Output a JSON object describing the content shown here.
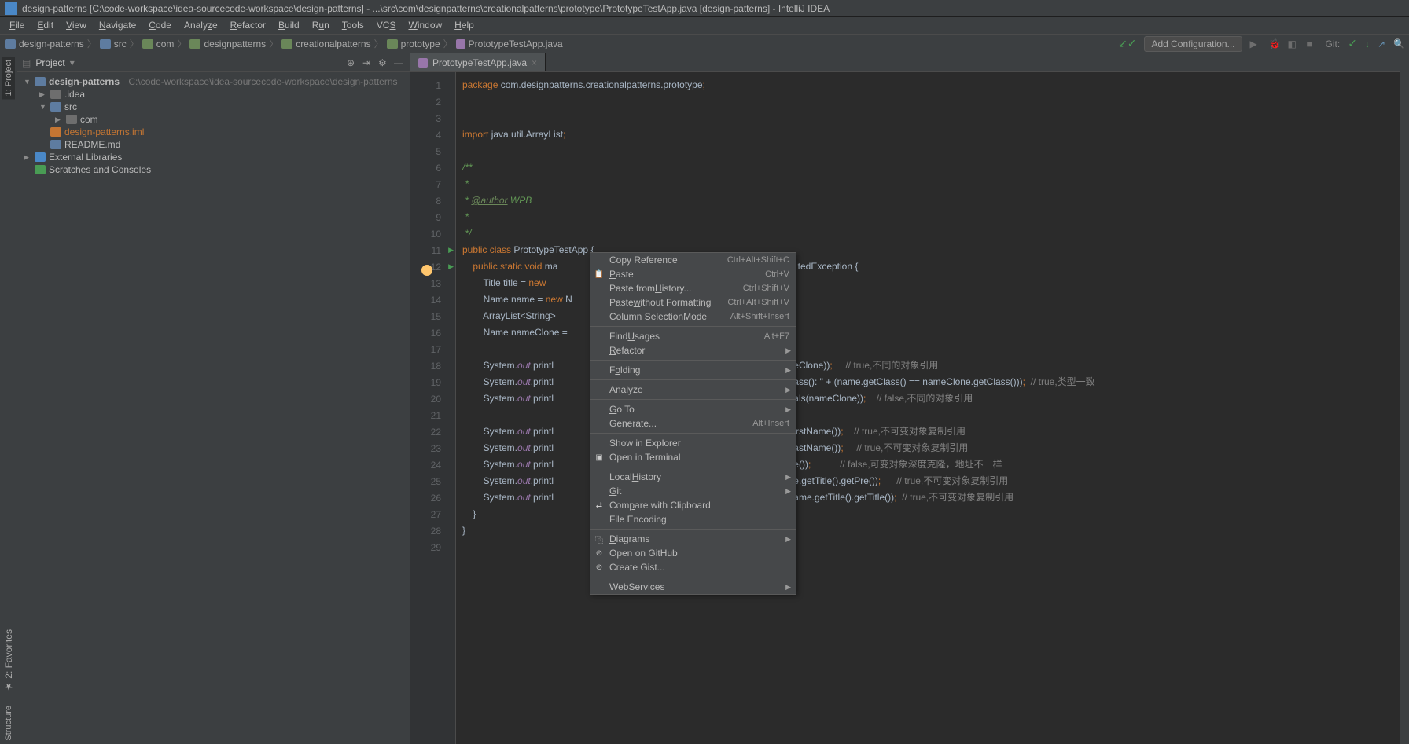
{
  "title": "design-patterns [C:\\code-workspace\\idea-sourcecode-workspace\\design-patterns] - ...\\src\\com\\designpatterns\\creationalpatterns\\prototype\\PrototypeTestApp.java [design-patterns] - IntelliJ IDEA",
  "menu": [
    "File",
    "Edit",
    "View",
    "Navigate",
    "Code",
    "Analyze",
    "Refactor",
    "Build",
    "Run",
    "Tools",
    "VCS",
    "Window",
    "Help"
  ],
  "breadcrumbs": [
    "design-patterns",
    "src",
    "com",
    "designpatterns",
    "creationalpatterns",
    "prototype",
    "PrototypeTestApp.java"
  ],
  "nav": {
    "addconf": "Add Configuration...",
    "git": "Git:"
  },
  "left_tabs": [
    "1: Project",
    "2: Favorites",
    "Structure"
  ],
  "sidebar": {
    "title": "Project"
  },
  "tree": {
    "root": "design-patterns",
    "root_path": "C:\\code-workspace\\idea-sourcecode-workspace\\design-patterns",
    "idea": ".idea",
    "src": "src",
    "com": "com",
    "iml": "design-patterns.iml",
    "readme": "README.md",
    "libs": "External Libraries",
    "scratch": "Scratches and Consoles"
  },
  "tab": {
    "name": "PrototypeTestApp.java"
  },
  "code": {
    "l1_a": "package ",
    "l1_b": "com.designpatterns.creationalpatterns.prototype",
    "l4_a": "import ",
    "l4_b": "java.util.ArrayList",
    "l6": "/**",
    "l7": " *",
    "l8a": " * ",
    "l8b": "@author",
    "l8c": " WPB",
    "l9": " *",
    "l10": " */",
    "l11_a": "public class ",
    "l11_b": "PrototypeTestApp {",
    "l12_a": "    public static void ",
    "l12_b": "ma",
    "l12_c": "tedException {",
    "l13_a": "        Title title = ",
    "l13_b": "new",
    "l14_a": "        Name name = ",
    "l14_b": "new ",
    "l14_c": "N",
    "l15": "        ArrayList<String>",
    "l16": "        Name nameClone = ",
    "l18_a": "        System.",
    "l18_b": "out",
    "l18_c": ".printl",
    "l18_d": "eClone))",
    "l18_e": ";     ",
    "l18_f": "// true,不同的对象引用",
    "l19_a": "        System.",
    "l19_b": "out",
    "l19_c": ".printl",
    "l19_d": "ass(): \" + (name.getClass() == nameClone.getClass()))",
    "l19_e": ";  ",
    "l19_f": "// true,类型一致",
    "l20_a": "        System.",
    "l20_b": "out",
    "l20_c": ".printl",
    "l20_d": "als(nameClone))",
    "l20_e": ";    ",
    "l20_f": "// false,不同的对象引用",
    "l22_a": "        System.",
    "l22_b": "out",
    "l22_c": ".printl",
    "l22_d": "irstName())",
    "l22_e": ";    ",
    "l22_f": "// true,不可变对象复制引用",
    "l23_a": "        System.",
    "l23_b": "out",
    "l23_c": ".printl",
    "l23_d": "astName())",
    "l23_e": ";     ",
    "l23_f": "// true,不可变对象复制引用",
    "l24_a": "        System.",
    "l24_b": "out",
    "l24_c": ".printl",
    "l24_d": "e())",
    "l24_e": ";           ",
    "l24_f": "// false,可变对象深度克隆，地址不一样",
    "l25_a": "        System.",
    "l25_b": "out",
    "l25_c": ".printl",
    "l25_d": "e.getTitle().getPre())",
    "l25_e": ";      ",
    "l25_f": "// true,不可变对象复制引用",
    "l26_a": "        System.",
    "l26_b": "out",
    "l26_c": ".printl",
    "l26_d": "ame.getTitle().getTitle())",
    "l26_e": ";  ",
    "l26_f": "// true,不可变对象复制引用",
    "l27": "    }",
    "l28": "}"
  },
  "ctx": {
    "copyref": "Copy Reference",
    "copyref_sc": "Ctrl+Alt+Shift+C",
    "paste": "Paste",
    "paste_sc": "Ctrl+V",
    "pastehist": "Paste from History...",
    "pastehist_sc": "Ctrl+Shift+V",
    "pastenofmt": "Paste without Formatting",
    "pastenofmt_sc": "Ctrl+Alt+Shift+V",
    "colsel": "Column Selection Mode",
    "colsel_sc": "Alt+Shift+Insert",
    "findusages": "Find Usages",
    "findusages_sc": "Alt+F7",
    "refactor": "Refactor",
    "folding": "Folding",
    "analyze": "Analyze",
    "goto": "Go To",
    "generate": "Generate...",
    "generate_sc": "Alt+Insert",
    "showexpl": "Show in Explorer",
    "openterm": "Open in Terminal",
    "localhist": "Local History",
    "git": "Git",
    "compare": "Compare with Clipboard",
    "fileenc": "File Encoding",
    "diagrams": "Diagrams",
    "opengh": "Open on GitHub",
    "gist": "Create Gist...",
    "webserv": "WebServices"
  }
}
